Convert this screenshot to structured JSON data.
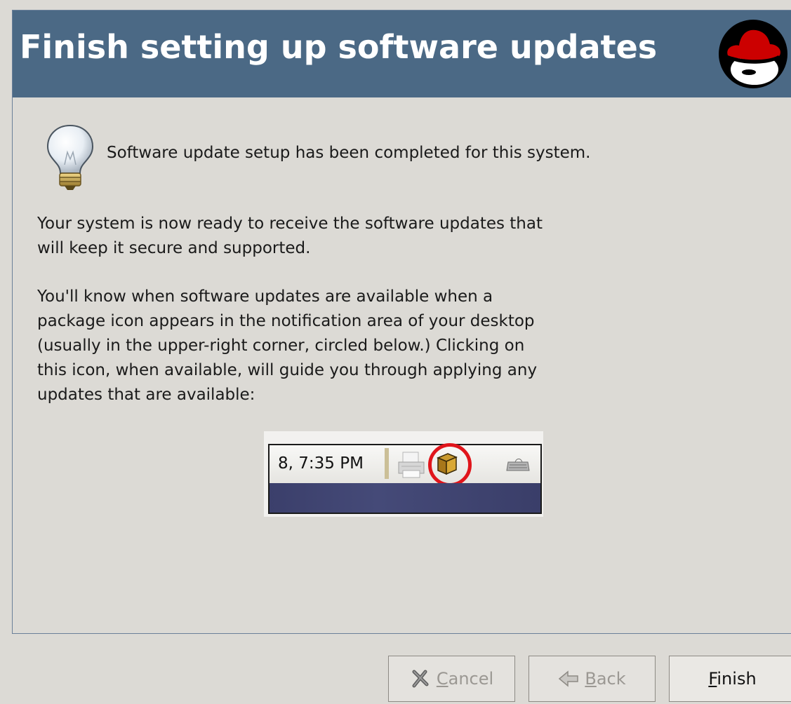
{
  "header": {
    "title": "Finish setting up software updates",
    "logo_icon": "redhat-shadowman-logo",
    "background_color": "#4b6985"
  },
  "info": {
    "icon": "lightbulb-icon",
    "message": "Software update setup has been completed for this system."
  },
  "paragraph1": {
    "lines": [
      "Your system is now ready to receive the software updates that",
      "will keep it secure and supported."
    ]
  },
  "paragraph2": {
    "lines": [
      "You'll know when software updates are available when a",
      "package icon appears in the notification area of your desktop",
      "(usually in the upper-right corner, circled below.) Clicking on",
      "this icon, when available, will guide you through applying any",
      "updates that are available:"
    ]
  },
  "tray_example": {
    "clock_text": "8,  7:35 PM",
    "icons": [
      "printer-icon",
      "package-icon",
      "keyboard-icon"
    ],
    "highlight_color": "#e0151b"
  },
  "buttons": {
    "cancel": {
      "label_underlined": "C",
      "label_rest": "ancel",
      "enabled": false,
      "icon": "cancel-x-icon"
    },
    "back": {
      "label_underlined": "B",
      "label_rest": "ack",
      "enabled": false,
      "icon": "back-arrow-icon"
    },
    "finish": {
      "label_underlined": "F",
      "label_rest": "inish",
      "enabled": true
    }
  }
}
